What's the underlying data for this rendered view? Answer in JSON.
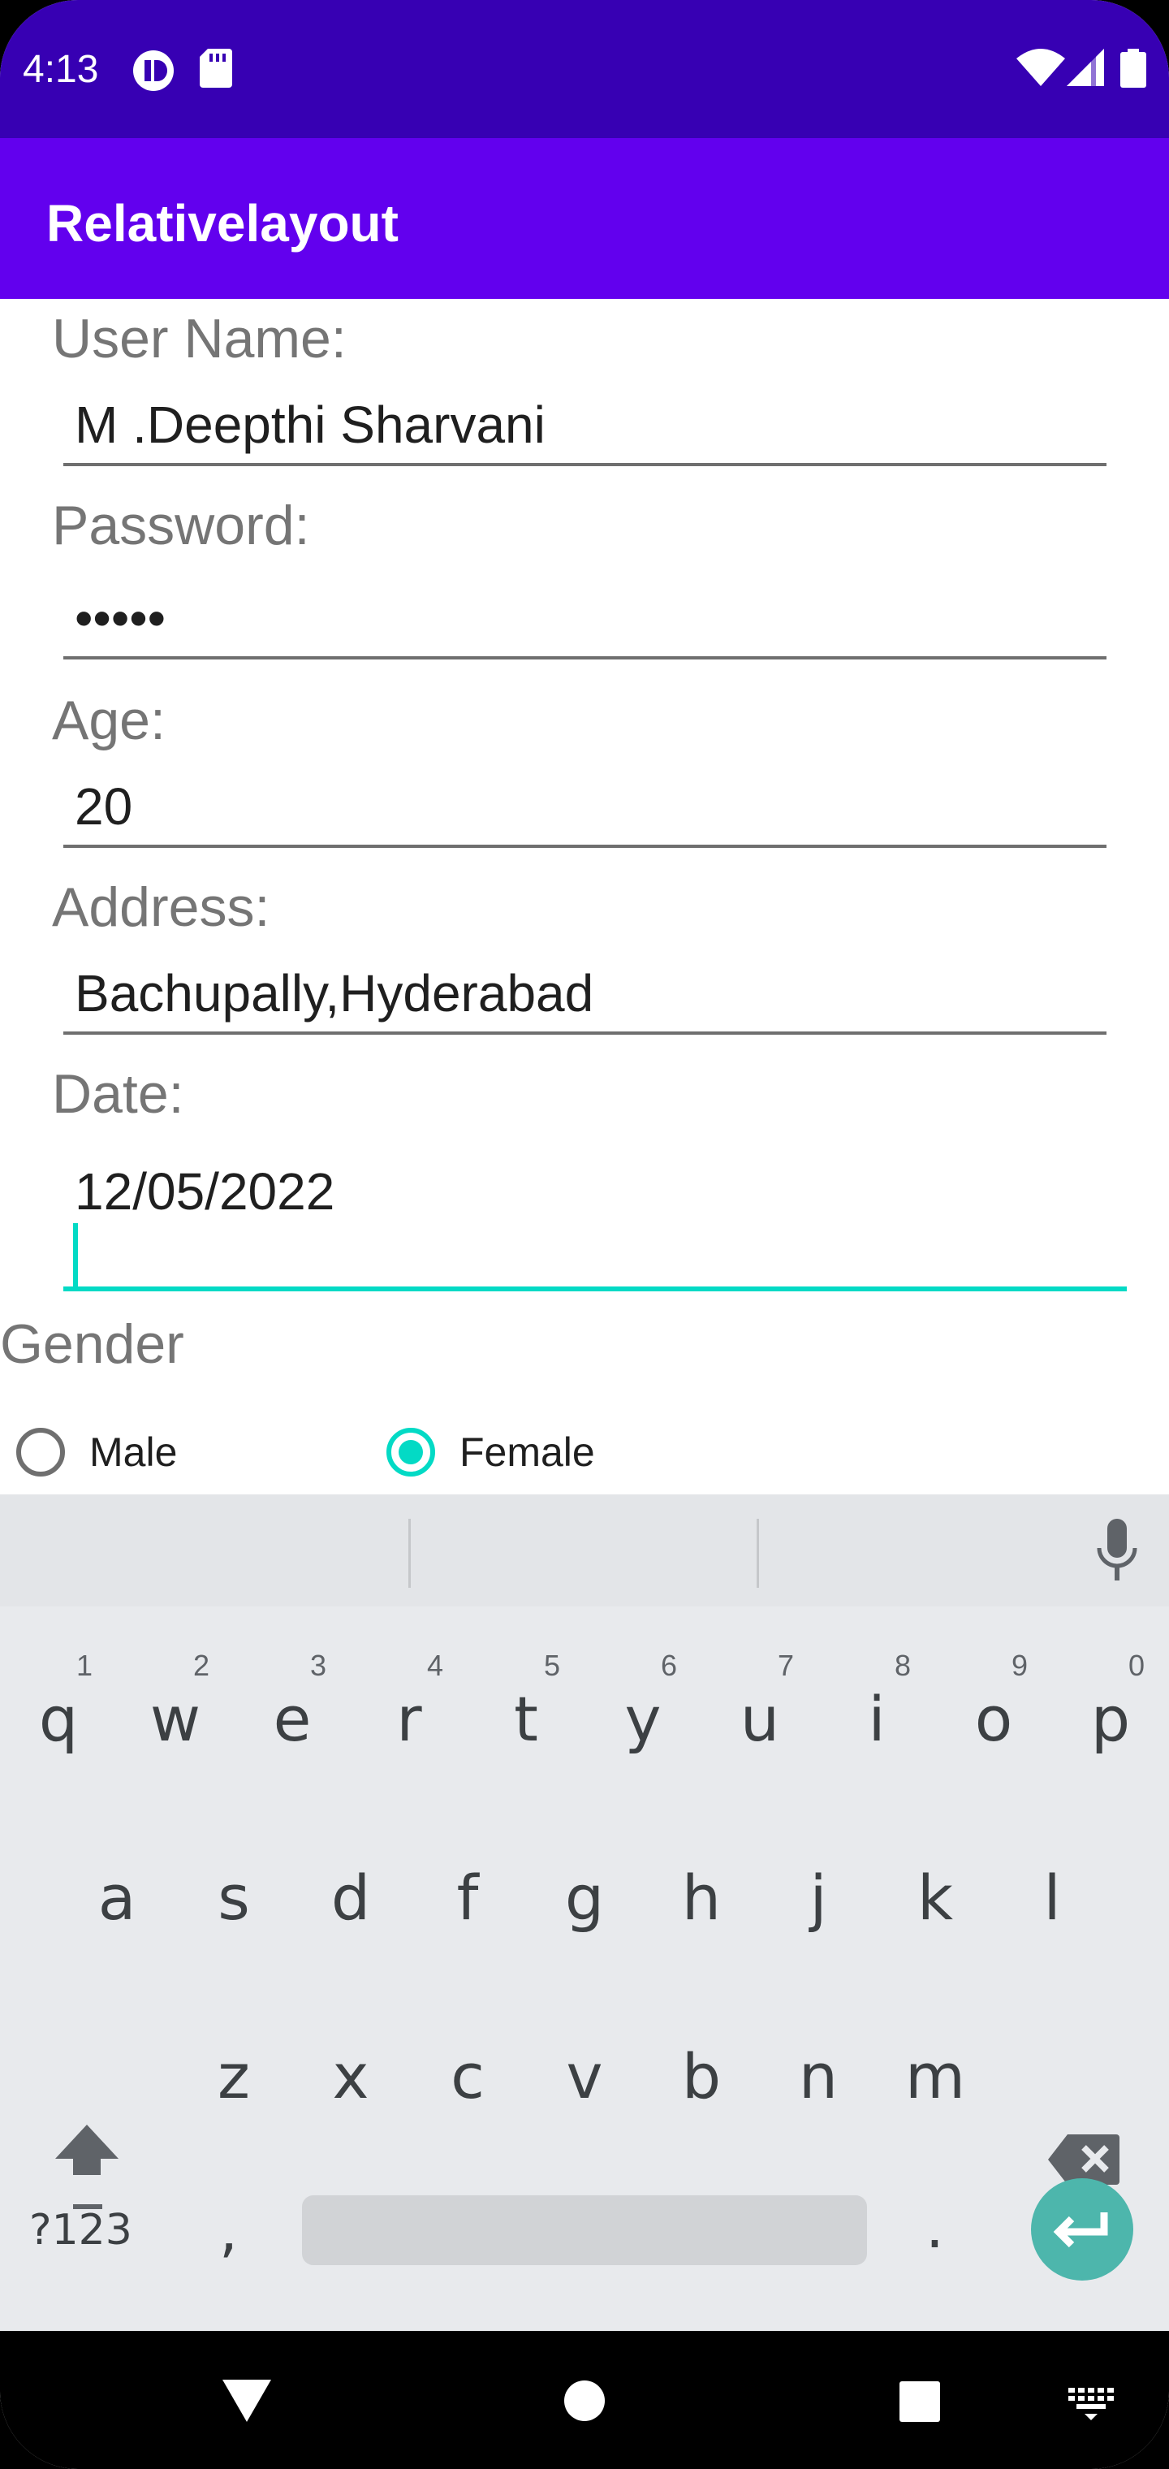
{
  "status_bar": {
    "time": "4:13",
    "icons": [
      "app-notification-icon",
      "sd-card-icon",
      "wifi-icon",
      "signal-icon",
      "battery-icon"
    ]
  },
  "app_bar": {
    "title": "Relativelayout"
  },
  "form": {
    "username": {
      "label": "User Name:",
      "value": "M .Deepthi Sharvani"
    },
    "password": {
      "label": "Password:",
      "value": "•••••"
    },
    "age": {
      "label": "Age:",
      "value": "20"
    },
    "address": {
      "label": "Address:",
      "value": "Bachupally,Hyderabad"
    },
    "date": {
      "label": "Date:",
      "value": "12/05/2022"
    },
    "gender": {
      "label": "Gender",
      "options": [
        {
          "label": "Male",
          "checked": false
        },
        {
          "label": "Female",
          "checked": true
        }
      ]
    }
  },
  "keyboard": {
    "row1": [
      "q",
      "w",
      "e",
      "r",
      "t",
      "y",
      "u",
      "i",
      "o",
      "p"
    ],
    "row1_hints": [
      "1",
      "2",
      "3",
      "4",
      "5",
      "6",
      "7",
      "8",
      "9",
      "0"
    ],
    "row2": [
      "a",
      "s",
      "d",
      "f",
      "g",
      "h",
      "j",
      "k",
      "l"
    ],
    "row3": [
      "z",
      "x",
      "c",
      "v",
      "b",
      "n",
      "m"
    ],
    "symbols_label": "?123",
    "comma": ",",
    "period": "."
  },
  "colors": {
    "status_bar": "#3700b3",
    "app_bar": "#6200ee",
    "accent": "#03dac5",
    "enter_key": "#4db6ac"
  }
}
